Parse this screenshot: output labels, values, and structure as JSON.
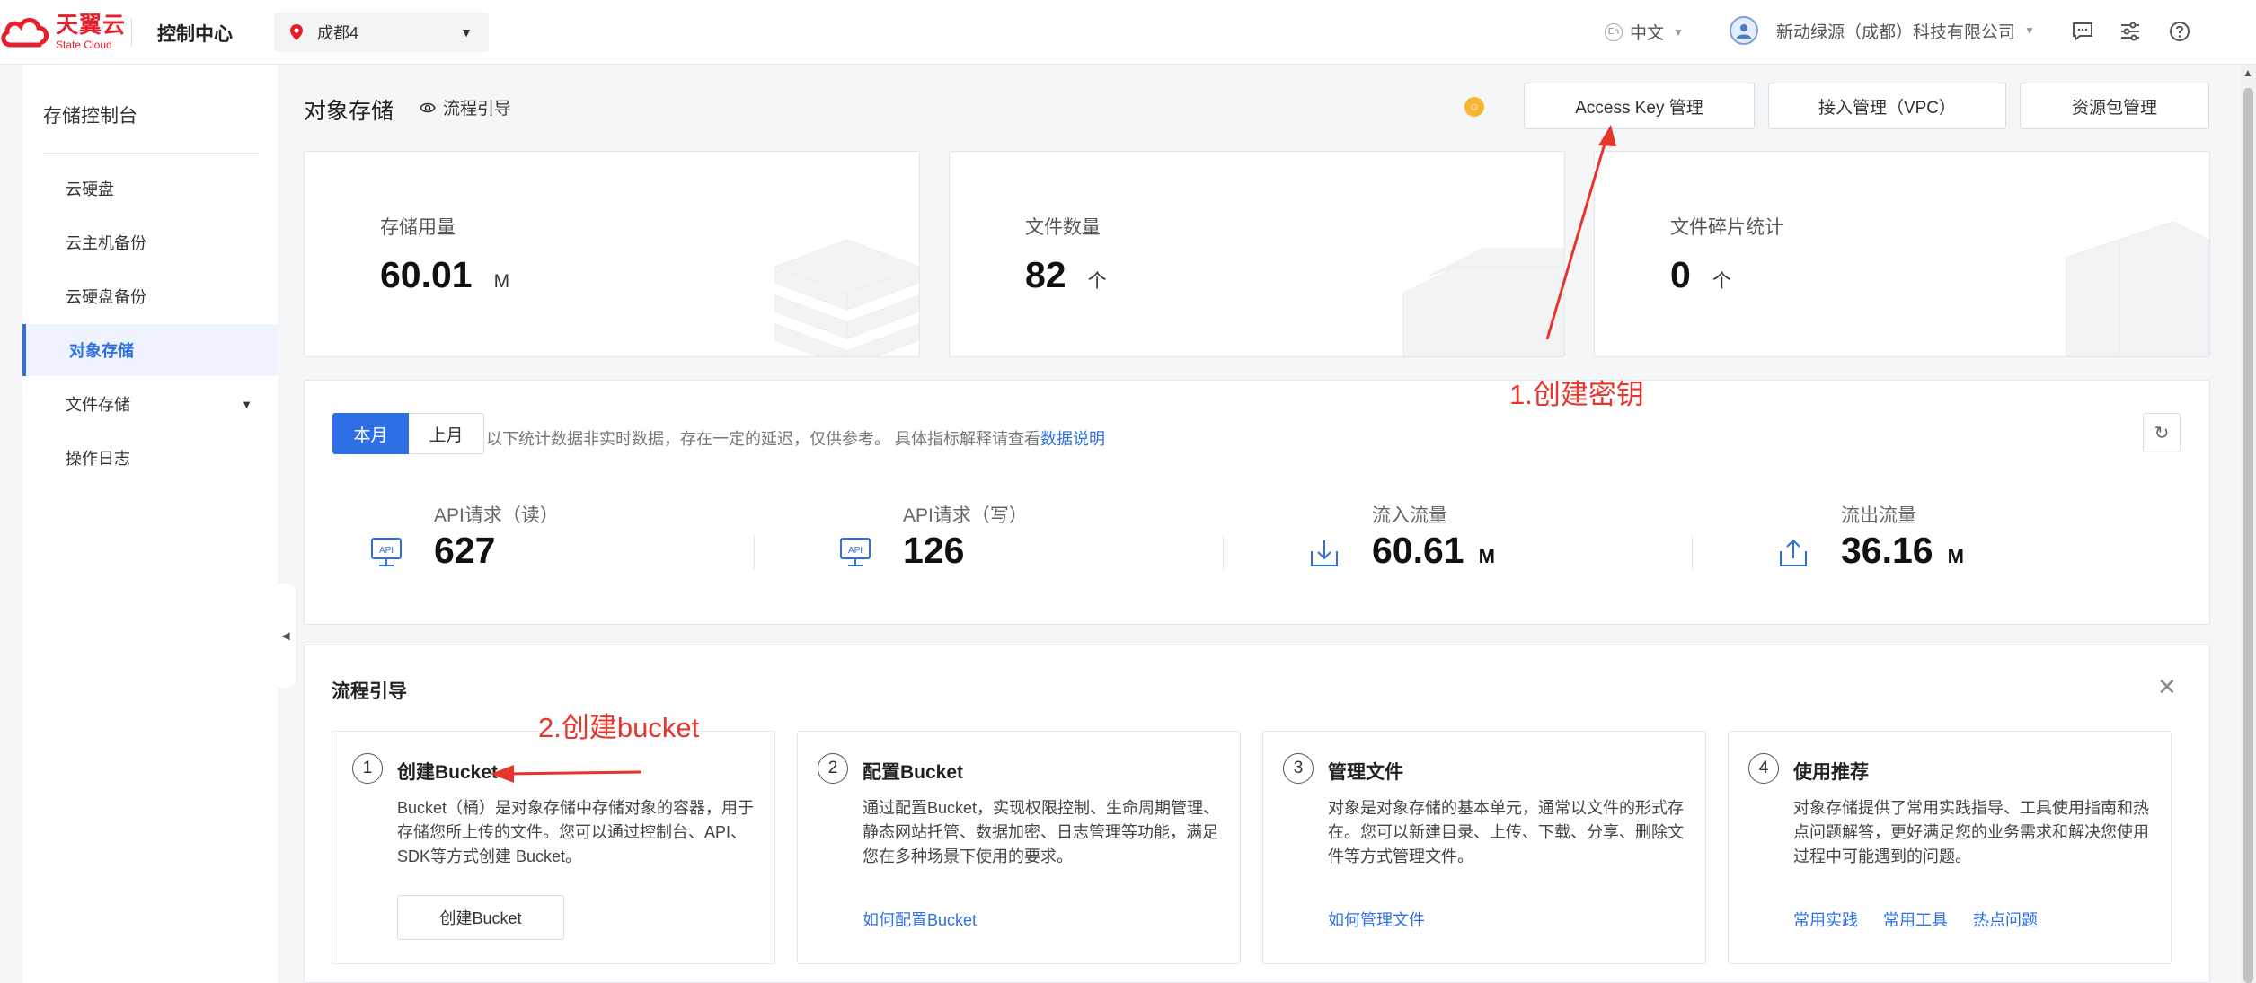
{
  "header": {
    "logo_cn": "天翼云",
    "logo_en": "State Cloud",
    "console_title": "控制中心",
    "region": "成都4",
    "lang": "中文",
    "lang_badge": "En",
    "company": "新动绿源（成都）科技有限公司"
  },
  "sidebar": {
    "title": "存储控制台",
    "items": [
      {
        "label": "云硬盘"
      },
      {
        "label": "云主机备份"
      },
      {
        "label": "云硬盘备份"
      },
      {
        "label": "对象存储"
      },
      {
        "label": "文件存储"
      },
      {
        "label": "操作日志"
      }
    ]
  },
  "page": {
    "title": "对象存储",
    "guide_link": "流程引导",
    "buttons": {
      "access_key": "Access Key 管理",
      "vpc": "接入管理（VPC）",
      "package": "资源包管理"
    }
  },
  "stats": [
    {
      "label": "存储用量",
      "value": "60.01",
      "unit": "M"
    },
    {
      "label": "文件数量",
      "value": "82",
      "unit": "个"
    },
    {
      "label": "文件碎片统计",
      "value": "0",
      "unit": "个"
    }
  ],
  "traffic": {
    "tab_current": "本月",
    "tab_last": "上月",
    "note": "以下统计数据非实时数据，存在一定的延迟，仅供参考。 具体指标解释请查看",
    "note_link": "数据说明",
    "metrics": [
      {
        "label": "API请求（读）",
        "value": "627",
        "unit": ""
      },
      {
        "label": "API请求（写）",
        "value": "126",
        "unit": ""
      },
      {
        "label": "流入流量",
        "value": "60.61",
        "unit": "M"
      },
      {
        "label": "流出流量",
        "value": "36.16",
        "unit": "M"
      }
    ],
    "api_badge": "API"
  },
  "guide": {
    "title": "流程引导",
    "steps": [
      {
        "num": "1",
        "title": "创建Bucket",
        "desc": "Bucket（桶）是对象存储中存储对象的容器，用于存储您所上传的文件。您可以通过控制台、API、SDK等方式创建 Bucket。",
        "button": "创建Bucket"
      },
      {
        "num": "2",
        "title": "配置Bucket",
        "desc": "通过配置Bucket，实现权限控制、生命周期管理、静态网站托管、数据加密、日志管理等功能，满足您在多种场景下使用的要求。",
        "link": "如何配置Bucket"
      },
      {
        "num": "3",
        "title": "管理文件",
        "desc": "对象是对象存储的基本单元，通常以文件的形式存在。您可以新建目录、上传、下载、分享、删除文件等方式管理文件。",
        "link": "如何管理文件"
      },
      {
        "num": "4",
        "title": "使用推荐",
        "desc": "对象存储提供了常用实践指导、工具使用指南和热点问题解答，更好满足您的业务需求和解决您使用过程中可能遇到的问题。",
        "links": [
          "常用实践",
          "常用工具",
          "热点问题"
        ]
      }
    ]
  },
  "annotations": {
    "step1": "1.创建密钥",
    "step2": "2.创建bucket",
    "color": "#e8352c"
  },
  "colors": {
    "primary": "#2f6fe5",
    "brand": "#e51f2b"
  }
}
